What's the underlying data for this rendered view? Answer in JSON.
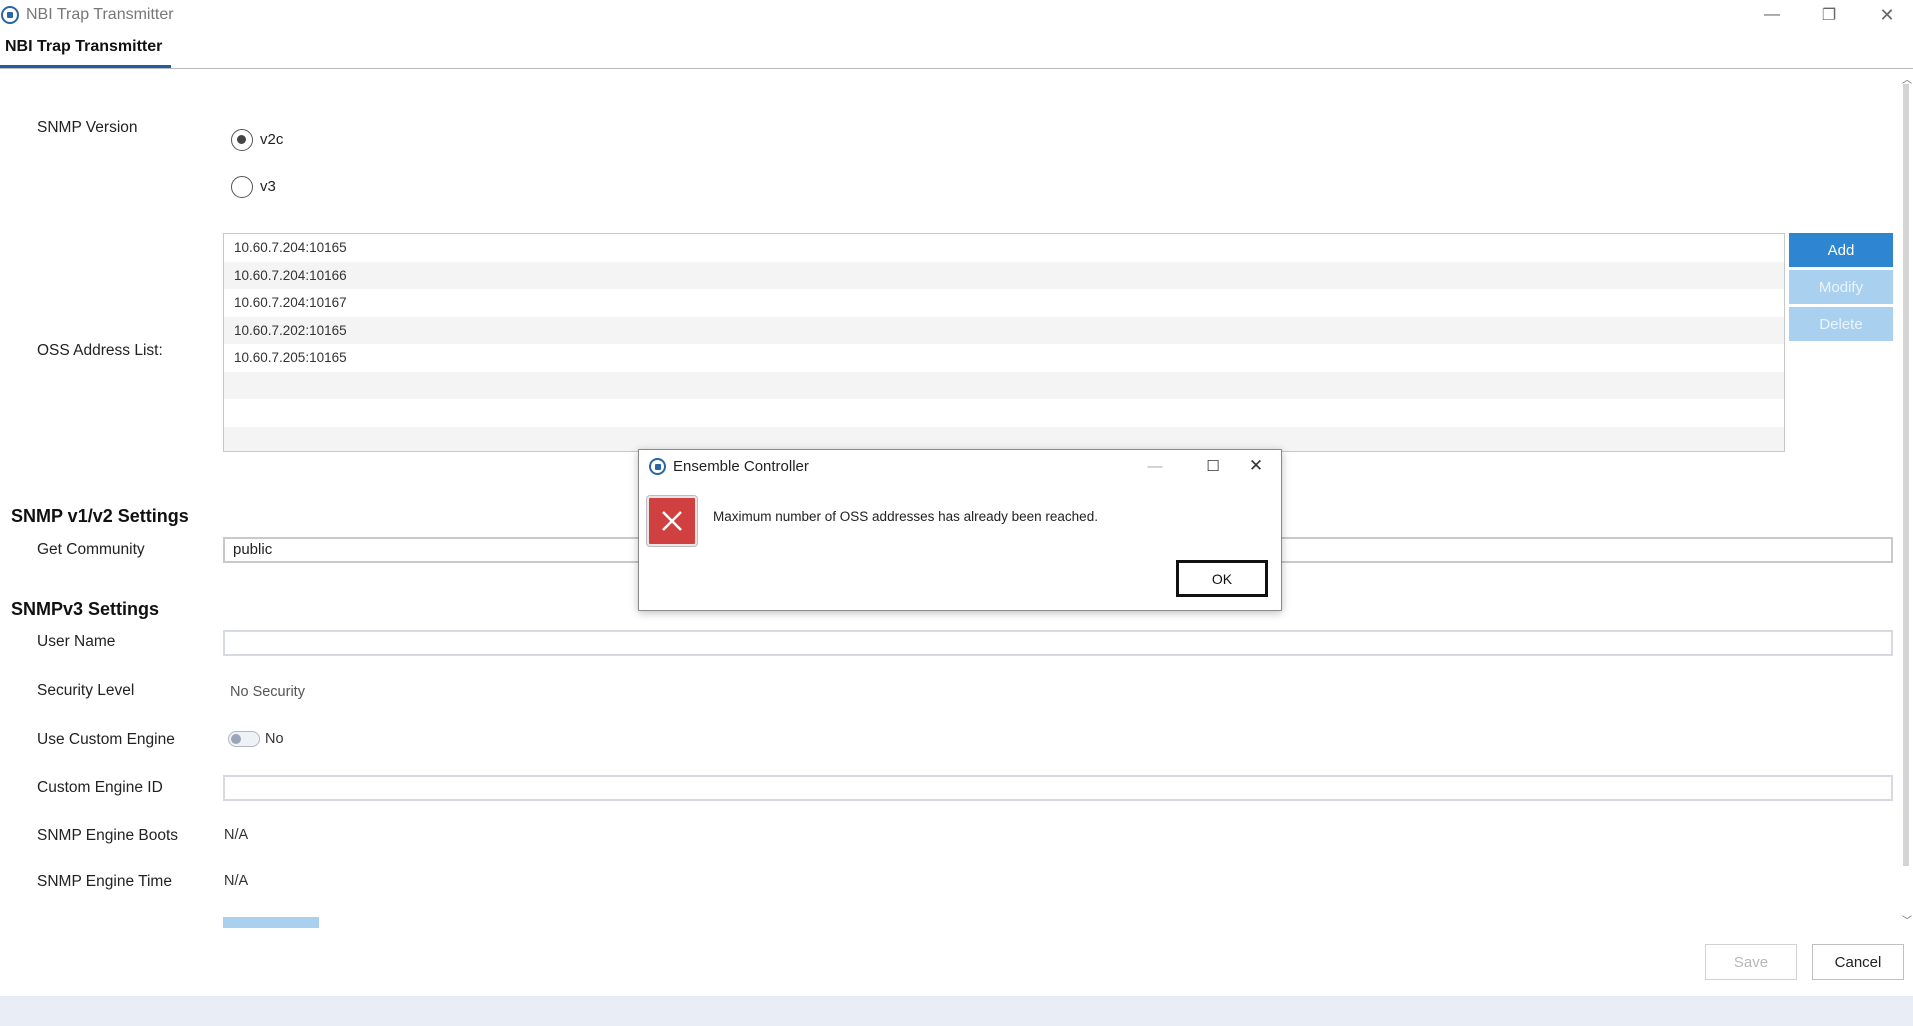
{
  "window": {
    "title": "NBI Trap Transmitter",
    "controls": {
      "minimize": "—",
      "restore": "❐",
      "close": "✕"
    }
  },
  "tab": {
    "label": "NBI Trap Transmitter"
  },
  "form": {
    "snmp_version_label": "SNMP Version",
    "versions": [
      {
        "label": "v2c",
        "selected": true
      },
      {
        "label": "v3",
        "selected": false
      }
    ],
    "oss_label": "OSS Address List:",
    "oss_addresses": [
      "10.60.7.204:10165",
      "10.60.7.204:10166",
      "10.60.7.204:10167",
      "10.60.7.202:10165",
      "10.60.7.205:10165"
    ],
    "oss_buttons": {
      "add": "Add",
      "modify": "Modify",
      "delete": "Delete"
    },
    "v1v2_section": "SNMP v1/v2 Settings",
    "get_community_label": "Get Community",
    "get_community_value": "public",
    "v3_section": "SNMPv3 Settings",
    "user_name_label": "User Name",
    "user_name_value": "",
    "security_level_label": "Security Level",
    "security_level_value": "No Security",
    "custom_engine_label": "Use Custom Engine",
    "custom_engine_value": "No",
    "custom_engine_id_label": "Custom Engine ID",
    "custom_engine_id_value": "",
    "engine_boots_label": "SNMP Engine Boots",
    "engine_boots_value": "N/A",
    "engine_time_label": "SNMP Engine Time",
    "engine_time_value": "N/A"
  },
  "footer_buttons": {
    "save": "Save",
    "cancel": "Cancel"
  },
  "dialog": {
    "title": "Ensemble Controller",
    "message": "Maximum number of OSS addresses has already been reached.",
    "ok": "OK",
    "controls": {
      "minimize": "—",
      "maximize": "☐",
      "close": "✕"
    }
  },
  "colors": {
    "accent": "#2e86d1",
    "accent_disabled": "#a9d1ef",
    "tab_underline": "#1f5fa0",
    "error": "#d04040"
  }
}
